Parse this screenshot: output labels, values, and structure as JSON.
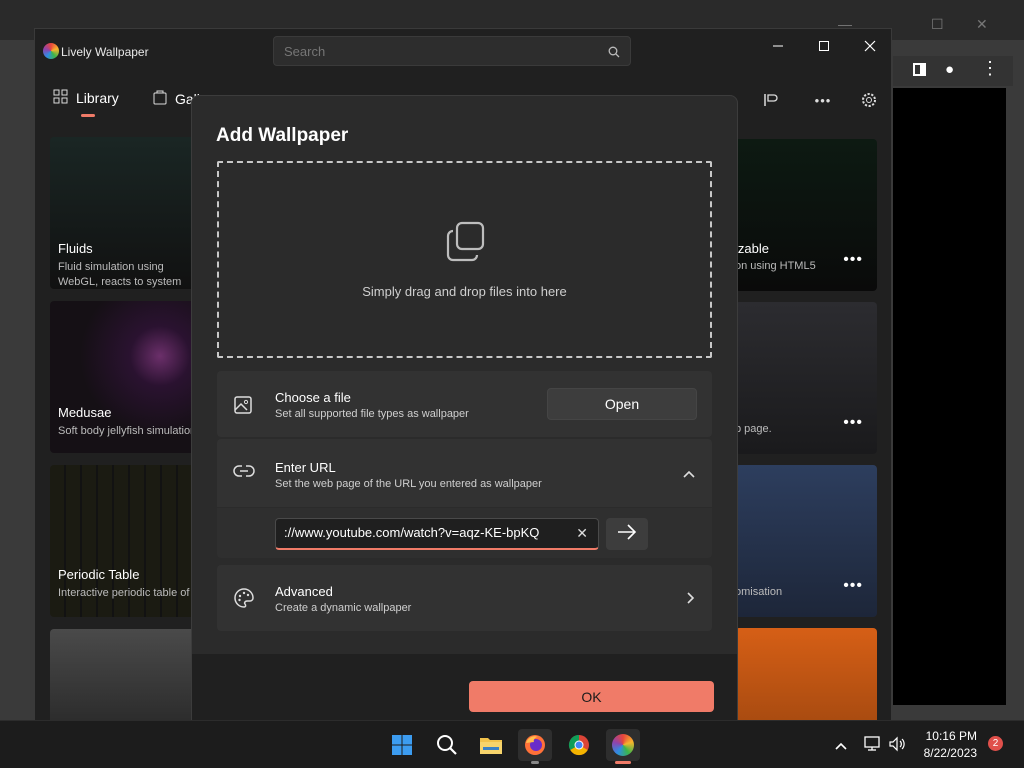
{
  "app": {
    "title": "Lively Wallpaper",
    "search_placeholder": "Search",
    "nav": {
      "library": "Library",
      "gallery": "Gallery"
    },
    "toolbar": {
      "more": "•••"
    }
  },
  "cards_left": [
    {
      "title": "Fluids",
      "desc": "Fluid simulation using WebGL, reacts to system audio & cursor."
    },
    {
      "title": "Medusae",
      "desc": "Soft body jellyfish simulation."
    },
    {
      "title": "Periodic Table",
      "desc": "Interactive periodic table of elements."
    }
  ],
  "cards_right": [
    {
      "title": "izable",
      "desc": "on using HTML5"
    },
    {
      "title": "",
      "desc": "b page."
    },
    {
      "title": "",
      "desc": "omisation"
    }
  ],
  "dialog": {
    "title": "Add Wallpaper",
    "drop_text": "Simply drag and drop files into here",
    "choose_file": {
      "title": "Choose a file",
      "subtitle": "Set all supported file types as wallpaper",
      "button": "Open"
    },
    "enter_url": {
      "title": "Enter URL",
      "subtitle": "Set the web page of the URL you entered as wallpaper",
      "value": "://www.youtube.com/watch?v=aqz-KE-bpKQ",
      "clear": "✕"
    },
    "advanced": {
      "title": "Advanced",
      "subtitle": "Create a dynamic wallpaper"
    },
    "ok": "OK"
  },
  "taskbar": {
    "time": "10:16 PM",
    "date": "8/22/2023",
    "notifications": "2"
  },
  "colors": {
    "accent": "#f07b68",
    "surface": "#2b2b2b",
    "card": "#323232"
  }
}
